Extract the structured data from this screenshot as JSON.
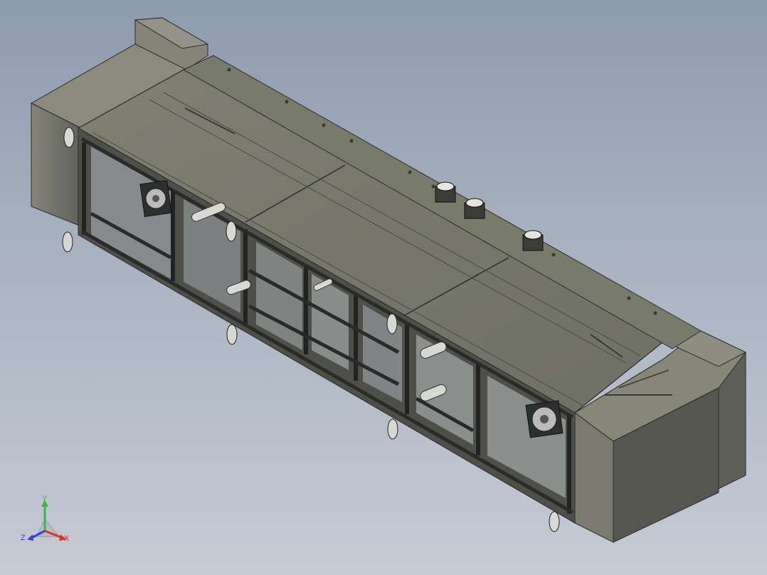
{
  "viewport": {
    "background_top": "#8e9bac",
    "background_bottom": "#c6cbd5",
    "view": "isometric"
  },
  "model": {
    "body_color": "#7b7b6d",
    "frame_color": "#3b3d3d",
    "panel_color": "#6f7063",
    "fan_count": 2,
    "motor_count": 3,
    "foot_count": 7
  },
  "triad": {
    "x_label": "X",
    "y_label": "Y",
    "z_label": "Z",
    "x_color": "#e0302a",
    "y_color": "#2fbf3a",
    "z_color": "#2f44d8"
  }
}
